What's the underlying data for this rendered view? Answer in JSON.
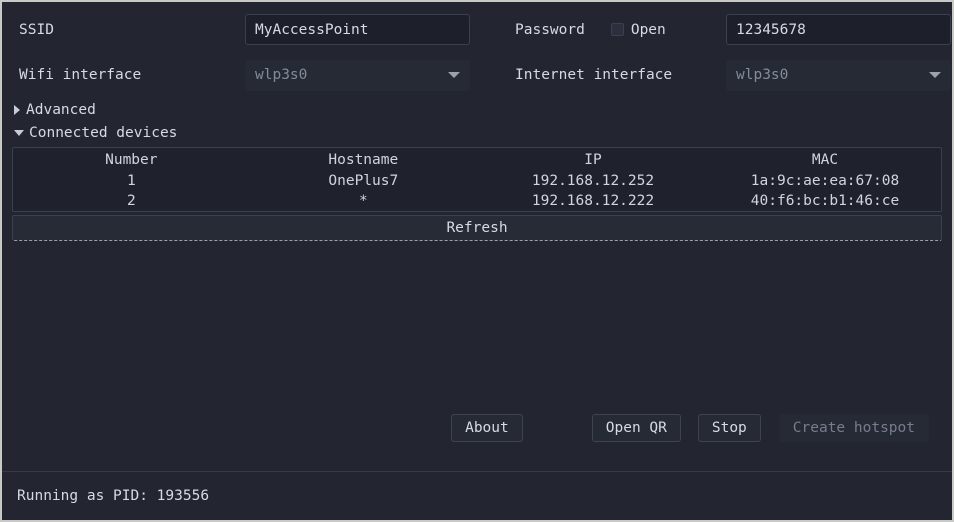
{
  "form": {
    "ssid": {
      "label": "SSID",
      "value": "MyAccessPoint",
      "placeholder": ""
    },
    "password": {
      "label": "Password",
      "open_checkbox_label": "Open",
      "open_checked": false,
      "value": "12345678",
      "placeholder": ""
    },
    "wifi_interface": {
      "label": "Wifi interface",
      "value": "wlp3s0"
    },
    "internet_interface": {
      "label": "Internet interface",
      "value": "wlp3s0"
    }
  },
  "expanders": {
    "advanced": {
      "label": "Advanced",
      "expanded": false
    },
    "connected_devices": {
      "label": "Connected devices",
      "expanded": true
    }
  },
  "devices_table": {
    "headers": [
      "Number",
      "Hostname",
      "IP",
      "MAC"
    ],
    "rows": [
      {
        "number": "1",
        "hostname": "OnePlus7",
        "ip": "192.168.12.252",
        "mac": "1a:9c:ae:ea:67:08"
      },
      {
        "number": "2",
        "hostname": "*",
        "ip": "192.168.12.222",
        "mac": "40:f6:bc:b1:46:ce"
      }
    ],
    "refresh_label": "Refresh"
  },
  "actions": {
    "about": "About",
    "open_qr": "Open QR",
    "stop": "Stop",
    "create_hotspot": "Create hotspot",
    "create_hotspot_disabled": true
  },
  "statusbar": {
    "text": "Running as PID: 193556"
  },
  "colors": {
    "window_bg": "#232630",
    "field_bg": "#1d202a",
    "border": "#3a4050",
    "text": "#d5dae4",
    "muted_text": "#838b9b",
    "frame": "#c9c9c6"
  }
}
